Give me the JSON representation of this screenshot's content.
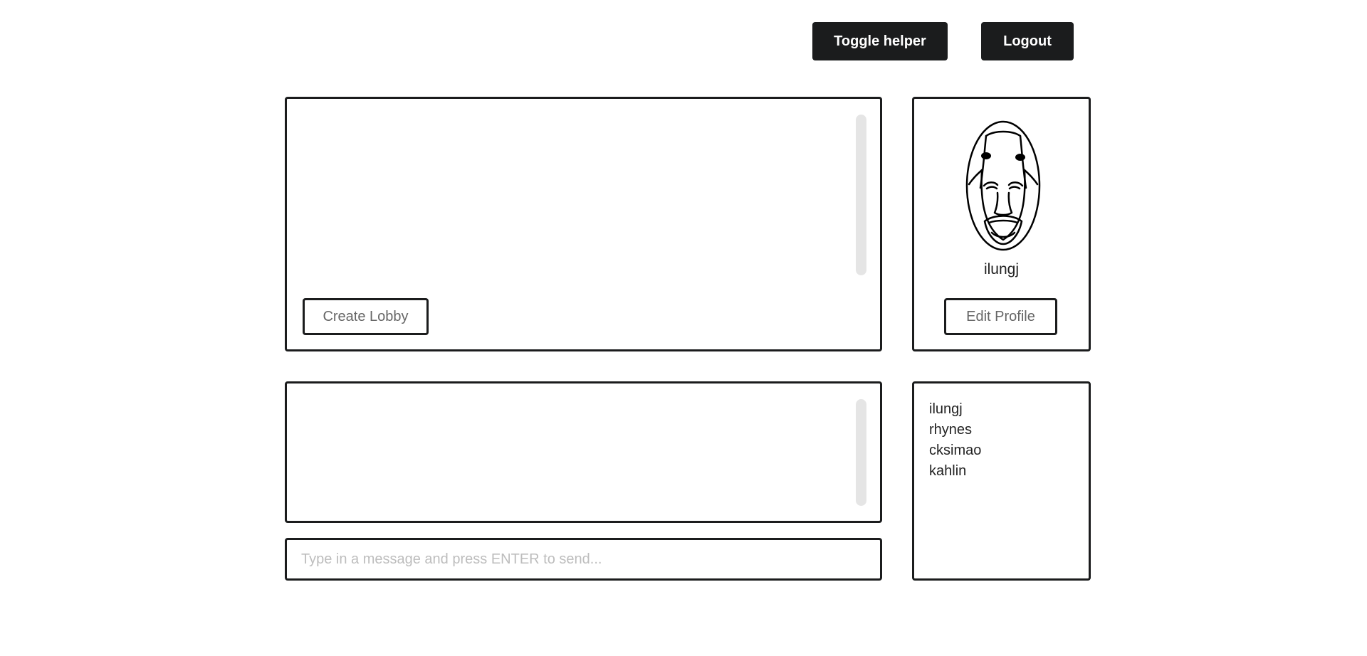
{
  "header": {
    "toggle_helper_label": "Toggle helper",
    "logout_label": "Logout"
  },
  "lobby": {
    "create_lobby_label": "Create Lobby"
  },
  "profile": {
    "avatar_icon": "laughing-face-avatar",
    "username": "ilungj",
    "edit_profile_label": "Edit Profile"
  },
  "chat": {
    "message_placeholder": "Type in a message and press ENTER to send..."
  },
  "users": {
    "items": [
      "ilungj",
      "rhynes",
      "cksimao",
      "kahlin"
    ]
  },
  "colors": {
    "dark": "#1b1c1d",
    "scrollbar": "#e5e5e5",
    "placeholder": "#bdbdbd"
  }
}
